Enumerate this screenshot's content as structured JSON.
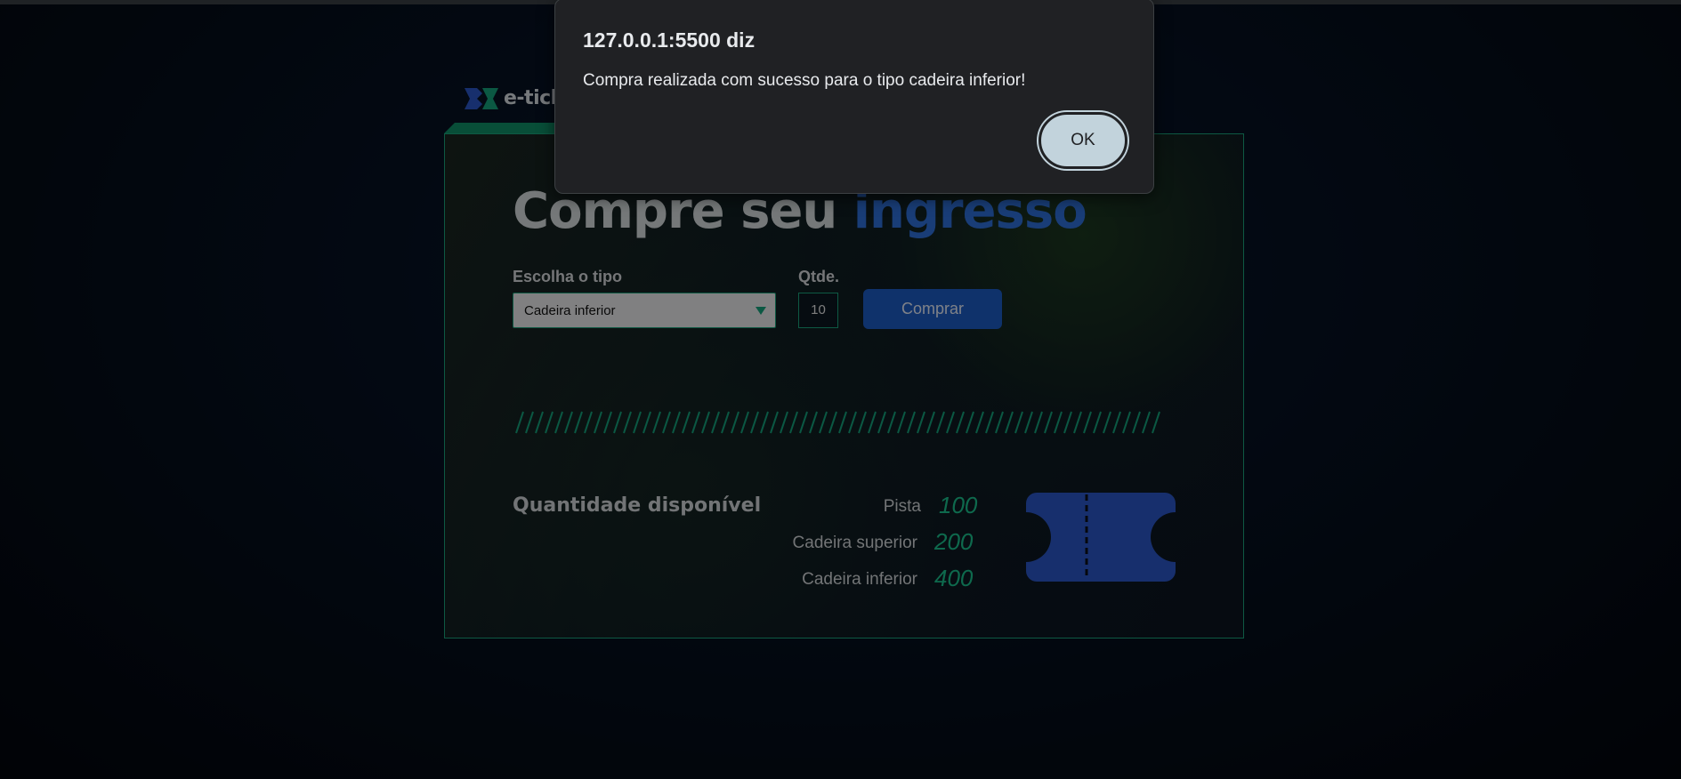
{
  "dialog": {
    "title": "127.0.0.1:5500 diz",
    "message": "Compra realizada com sucesso para o tipo cadeira inferior!",
    "ok_label": "OK"
  },
  "logo": {
    "text": "e-tick"
  },
  "form": {
    "title_part1": "Compre seu ",
    "title_part2": "ingresso",
    "type_label": "Escolha o tipo",
    "type_selected": "Cadeira inferior",
    "qty_label": "Qtde.",
    "qty_value": "10",
    "buy_label": "Comprar"
  },
  "availability": {
    "title": "Quantidade disponível",
    "rows": [
      {
        "label": "Pista",
        "value": "100"
      },
      {
        "label": "Cadeira superior",
        "value": "200"
      },
      {
        "label": "Cadeira inferior",
        "value": "400"
      }
    ]
  },
  "colors": {
    "accent_green": "#1aa37a",
    "accent_blue": "#1c5bc4",
    "dialog_bg": "#202124",
    "ok_button": "#c2d3dc"
  }
}
